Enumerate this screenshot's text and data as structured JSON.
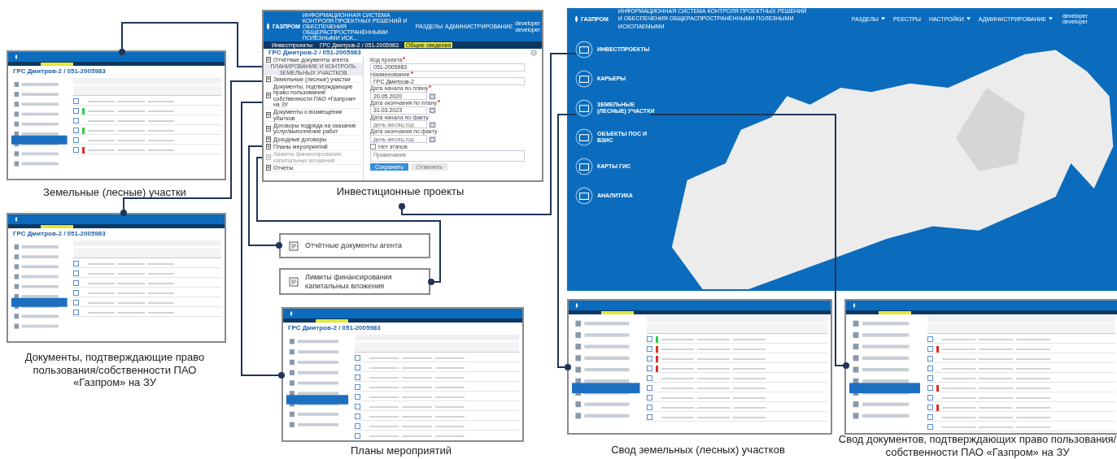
{
  "thumbnails": [
    {
      "caption": "Земельные (лесные) участки",
      "title": "ГРС Дмитров-2 / 051-2005983",
      "rows": [
        {
          "color": null
        },
        {
          "color": "#2ecc40"
        },
        {
          "color": null
        },
        {
          "color": "#2ecc40"
        },
        {
          "color": null
        },
        {
          "color": "#e8281e"
        }
      ]
    },
    {
      "caption": "Документы, подтверждающие право пользования/собственности ПАО «Газпром» на ЗУ",
      "title": "ГРС Дмитров-2 / 051-2005983",
      "rows": [
        {
          "color": null
        },
        {
          "color": null
        },
        {
          "color": null
        },
        {
          "color": null
        },
        {
          "color": null
        },
        {
          "color": null
        }
      ]
    },
    {
      "caption": "Планы мероприятий",
      "title": "ГРС Дмитров-2 / 051-2005983",
      "rows": [
        {
          "color": null
        },
        {
          "color": null
        },
        {
          "color": null
        },
        {
          "color": null
        },
        {
          "color": null
        },
        {
          "color": null
        },
        {
          "color": null
        },
        {
          "color": null
        },
        {
          "color": null
        }
      ]
    },
    {
      "caption": "Свод земельных (лесных) участков",
      "rows": [
        {
          "color": "#2ecc40"
        },
        {
          "color": "#e8281e"
        },
        {
          "color": "#e8281e"
        },
        {
          "color": "#e8281e"
        },
        {
          "color": null
        },
        {
          "color": null
        },
        {
          "color": null
        },
        {
          "color": null
        },
        {
          "color": null
        }
      ]
    },
    {
      "caption": "Свод документов, подтверждающих право пользования/собственности ПАО «Газпром» на ЗУ",
      "rows": [
        {
          "color": null
        },
        {
          "color": "#e8281e"
        },
        {
          "color": null
        },
        {
          "color": null
        },
        {
          "color": null
        },
        {
          "color": "#e8281e"
        },
        {
          "color": null
        },
        {
          "color": "#e8281e"
        },
        {
          "color": null
        },
        {
          "color": null
        }
      ]
    }
  ],
  "investment_project": {
    "caption": "Инвестиционные проекты",
    "logo": "ГАЗПРОМ",
    "header_title": "ИНФОРМАЦИОННАЯ СИСТЕМА КОНТРОЛЯ ПРОЕКТНЫХ РЕШЕНИЙ И ОБЕСПЕЧЕНИЯ ОБЩЕРАСПРОСТРАНЁННЫМИ ПОЛЕЗНЫМИ ИСК...",
    "nav": [
      "РАЗДЕЛЫ",
      "АДМИНИСТРИРОВАНИЕ"
    ],
    "user": "developer developer",
    "breadcrumbs": [
      {
        "label": "Инвестпроекты",
        "selected": false
      },
      {
        "label": "ГРС Дмитров-2 / 051-2005983",
        "selected": false
      },
      {
        "label": "Общие сведения",
        "selected": true
      }
    ],
    "title": "ГРС Дмитров-2 / 051-2005983",
    "sidebar": [
      {
        "kind": "item",
        "label": "Отчётные документы агента",
        "disabled": false
      },
      {
        "kind": "section",
        "label": "ПЛАНИРОВАНИЕ И КОНТРОЛЬ ЗЕМЕЛЬНЫХ УЧАСТКОВ"
      },
      {
        "kind": "item",
        "label": "Земельные (лесные) участки",
        "disabled": false
      },
      {
        "kind": "item",
        "label": "Документы, подтверждающие право пользования/ собственности ПАО «Газпром» на ЗУ",
        "disabled": false
      },
      {
        "kind": "item",
        "label": "Документы о возмещении убытков",
        "disabled": false
      },
      {
        "kind": "item",
        "label": "Договоры подряда на оказание услуг/выполнение работ",
        "disabled": false
      },
      {
        "kind": "item",
        "label": "Доходные договоры",
        "disabled": false
      },
      {
        "kind": "item",
        "label": "Планы мероприятий",
        "disabled": false
      },
      {
        "kind": "item",
        "label": "Лимиты финансирования капитальных вложения",
        "disabled": true
      },
      {
        "kind": "item",
        "label": "Отчеты",
        "disabled": false
      }
    ],
    "fields": [
      {
        "kind": "text",
        "label": "Код проекта",
        "required": true,
        "value": "051-2005983"
      },
      {
        "kind": "text",
        "label": "Наименование",
        "required": true,
        "value": "ГРС Дмитров-2"
      },
      {
        "kind": "date",
        "label": "Дата начала по плану",
        "required": true,
        "value": "20.05.2020"
      },
      {
        "kind": "date",
        "label": "Дата окончания по плану",
        "required": true,
        "value": "31.03.2023"
      },
      {
        "kind": "date",
        "label": "Дата начала по факту",
        "required": false,
        "placeholder": "день.месяц.год"
      },
      {
        "kind": "date",
        "label": "Дата окончания по факту",
        "required": false,
        "placeholder": "день.месяц.год"
      }
    ],
    "checkbox": {
      "label": "Нет этапов",
      "checked": false
    },
    "note": {
      "placeholder": "Примечание"
    },
    "buttons": [
      {
        "kind": "primary",
        "label": "Сохранить"
      },
      {
        "kind": "secondary",
        "label": "Отменить"
      }
    ]
  },
  "callouts": [
    {
      "label": "Отчётные документы агента"
    },
    {
      "label": "Лимиты финансирования капитальных вложения"
    }
  ],
  "main_map": {
    "logo": "ГАЗПРОМ",
    "header_lines": [
      "ИНФОРМАЦИОННАЯ СИСТЕМА КОНТРОЛЯ ПРОЕКТНЫХ РЕШЕНИЙ",
      "И ОБЕСПЕЧЕНИЯ ОБЩЕРАСПРОСТРАНЁННЫМИ ПОЛЕЗНЫМИ ИСКОПАЕМЫМИ"
    ],
    "nav": [
      {
        "label": "РАЗДЕЛЫ",
        "dropdown": true
      },
      {
        "label": "РЕЕСТРЫ",
        "dropdown": false
      },
      {
        "label": "НАСТРОЙКИ",
        "dropdown": true
      },
      {
        "label": "АДМИНИСТРИРОВАНИЕ",
        "dropdown": true
      }
    ],
    "user": "developer developer",
    "menu": [
      "ИНВЕСТПРОЕКТЫ",
      "КАРЬЕРЫ",
      "ЗЕМЕЛЬНЫЕ (ЛЕСНЫЕ) УЧАСТКИ",
      "ОБЪЕКТЫ ПОС И ВЗИС",
      "КАРТЫ ГИС",
      "АНАЛИТИКА"
    ]
  }
}
